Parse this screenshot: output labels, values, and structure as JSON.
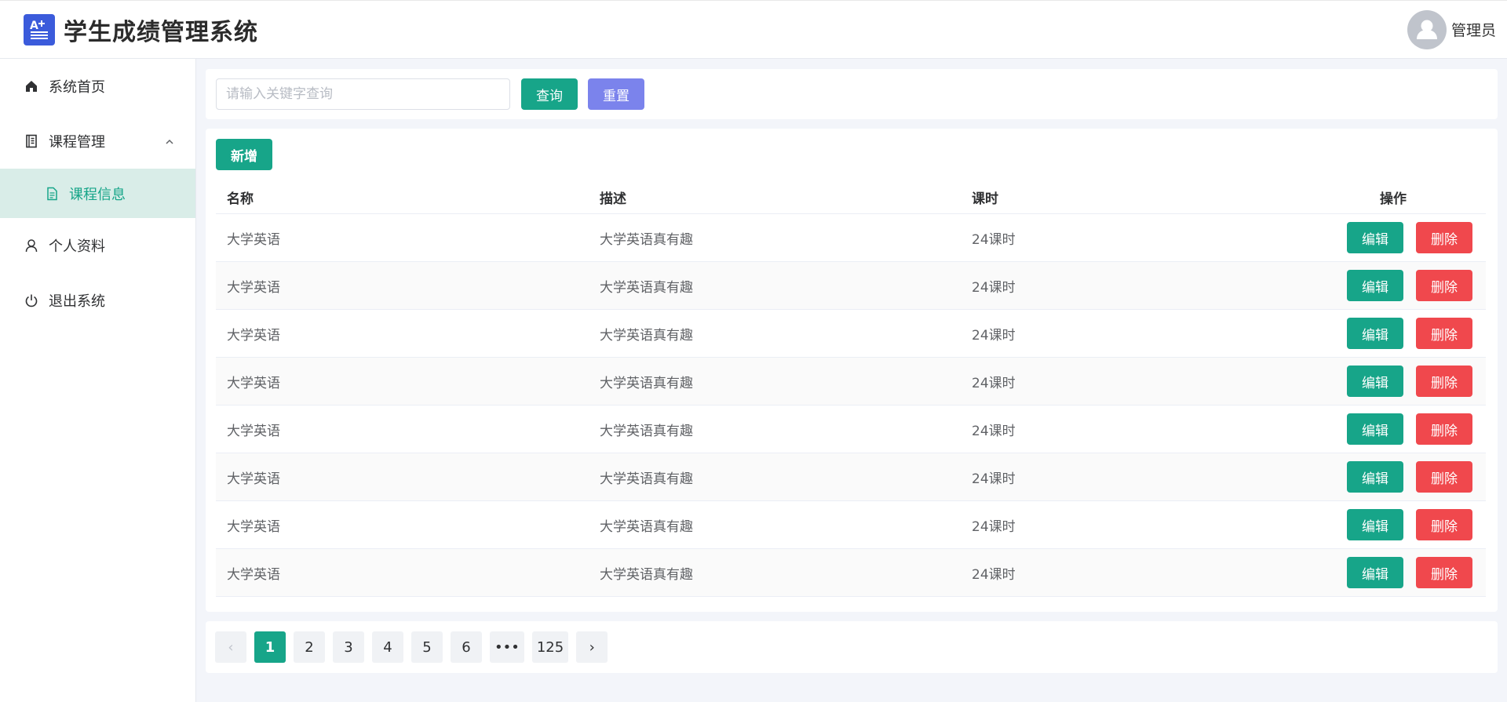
{
  "header": {
    "app_title": "学生成绩管理系统",
    "username": "管理员",
    "logo_icon": "a-plus-list-icon",
    "avatar_icon": "user-avatar-icon"
  },
  "sidebar": {
    "items": [
      {
        "label": "系统首页",
        "icon": "home-icon"
      },
      {
        "label": "课程管理",
        "icon": "notebook-icon",
        "expanded": true
      },
      {
        "label": "课程信息",
        "icon": "document-icon",
        "active": true
      },
      {
        "label": "个人资料",
        "icon": "user-icon"
      },
      {
        "label": "退出系统",
        "icon": "power-icon"
      }
    ]
  },
  "search": {
    "placeholder": "请输入关键字查询",
    "value": "",
    "query_label": "查询",
    "reset_label": "重置"
  },
  "table": {
    "add_label": "新增",
    "columns": [
      "名称",
      "描述",
      "课时",
      "操作"
    ],
    "edit_label": "编辑",
    "delete_label": "删除",
    "rows": [
      {
        "name": "大学英语",
        "desc": "大学英语真有趣",
        "hours": "24课时"
      },
      {
        "name": "大学英语",
        "desc": "大学英语真有趣",
        "hours": "24课时"
      },
      {
        "name": "大学英语",
        "desc": "大学英语真有趣",
        "hours": "24课时"
      },
      {
        "name": "大学英语",
        "desc": "大学英语真有趣",
        "hours": "24课时"
      },
      {
        "name": "大学英语",
        "desc": "大学英语真有趣",
        "hours": "24课时"
      },
      {
        "name": "大学英语",
        "desc": "大学英语真有趣",
        "hours": "24课时"
      },
      {
        "name": "大学英语",
        "desc": "大学英语真有趣",
        "hours": "24课时"
      },
      {
        "name": "大学英语",
        "desc": "大学英语真有趣",
        "hours": "24课时"
      }
    ]
  },
  "pagination": {
    "prev": "‹",
    "next": "›",
    "pages": [
      "1",
      "2",
      "3",
      "4",
      "5",
      "6",
      "•••",
      "125"
    ],
    "current": "1"
  },
  "colors": {
    "primary": "#17a589",
    "reset": "#7b83ec",
    "danger": "#f0484d",
    "logo": "#3b5bdb",
    "active_bg": "#d9ede8"
  }
}
